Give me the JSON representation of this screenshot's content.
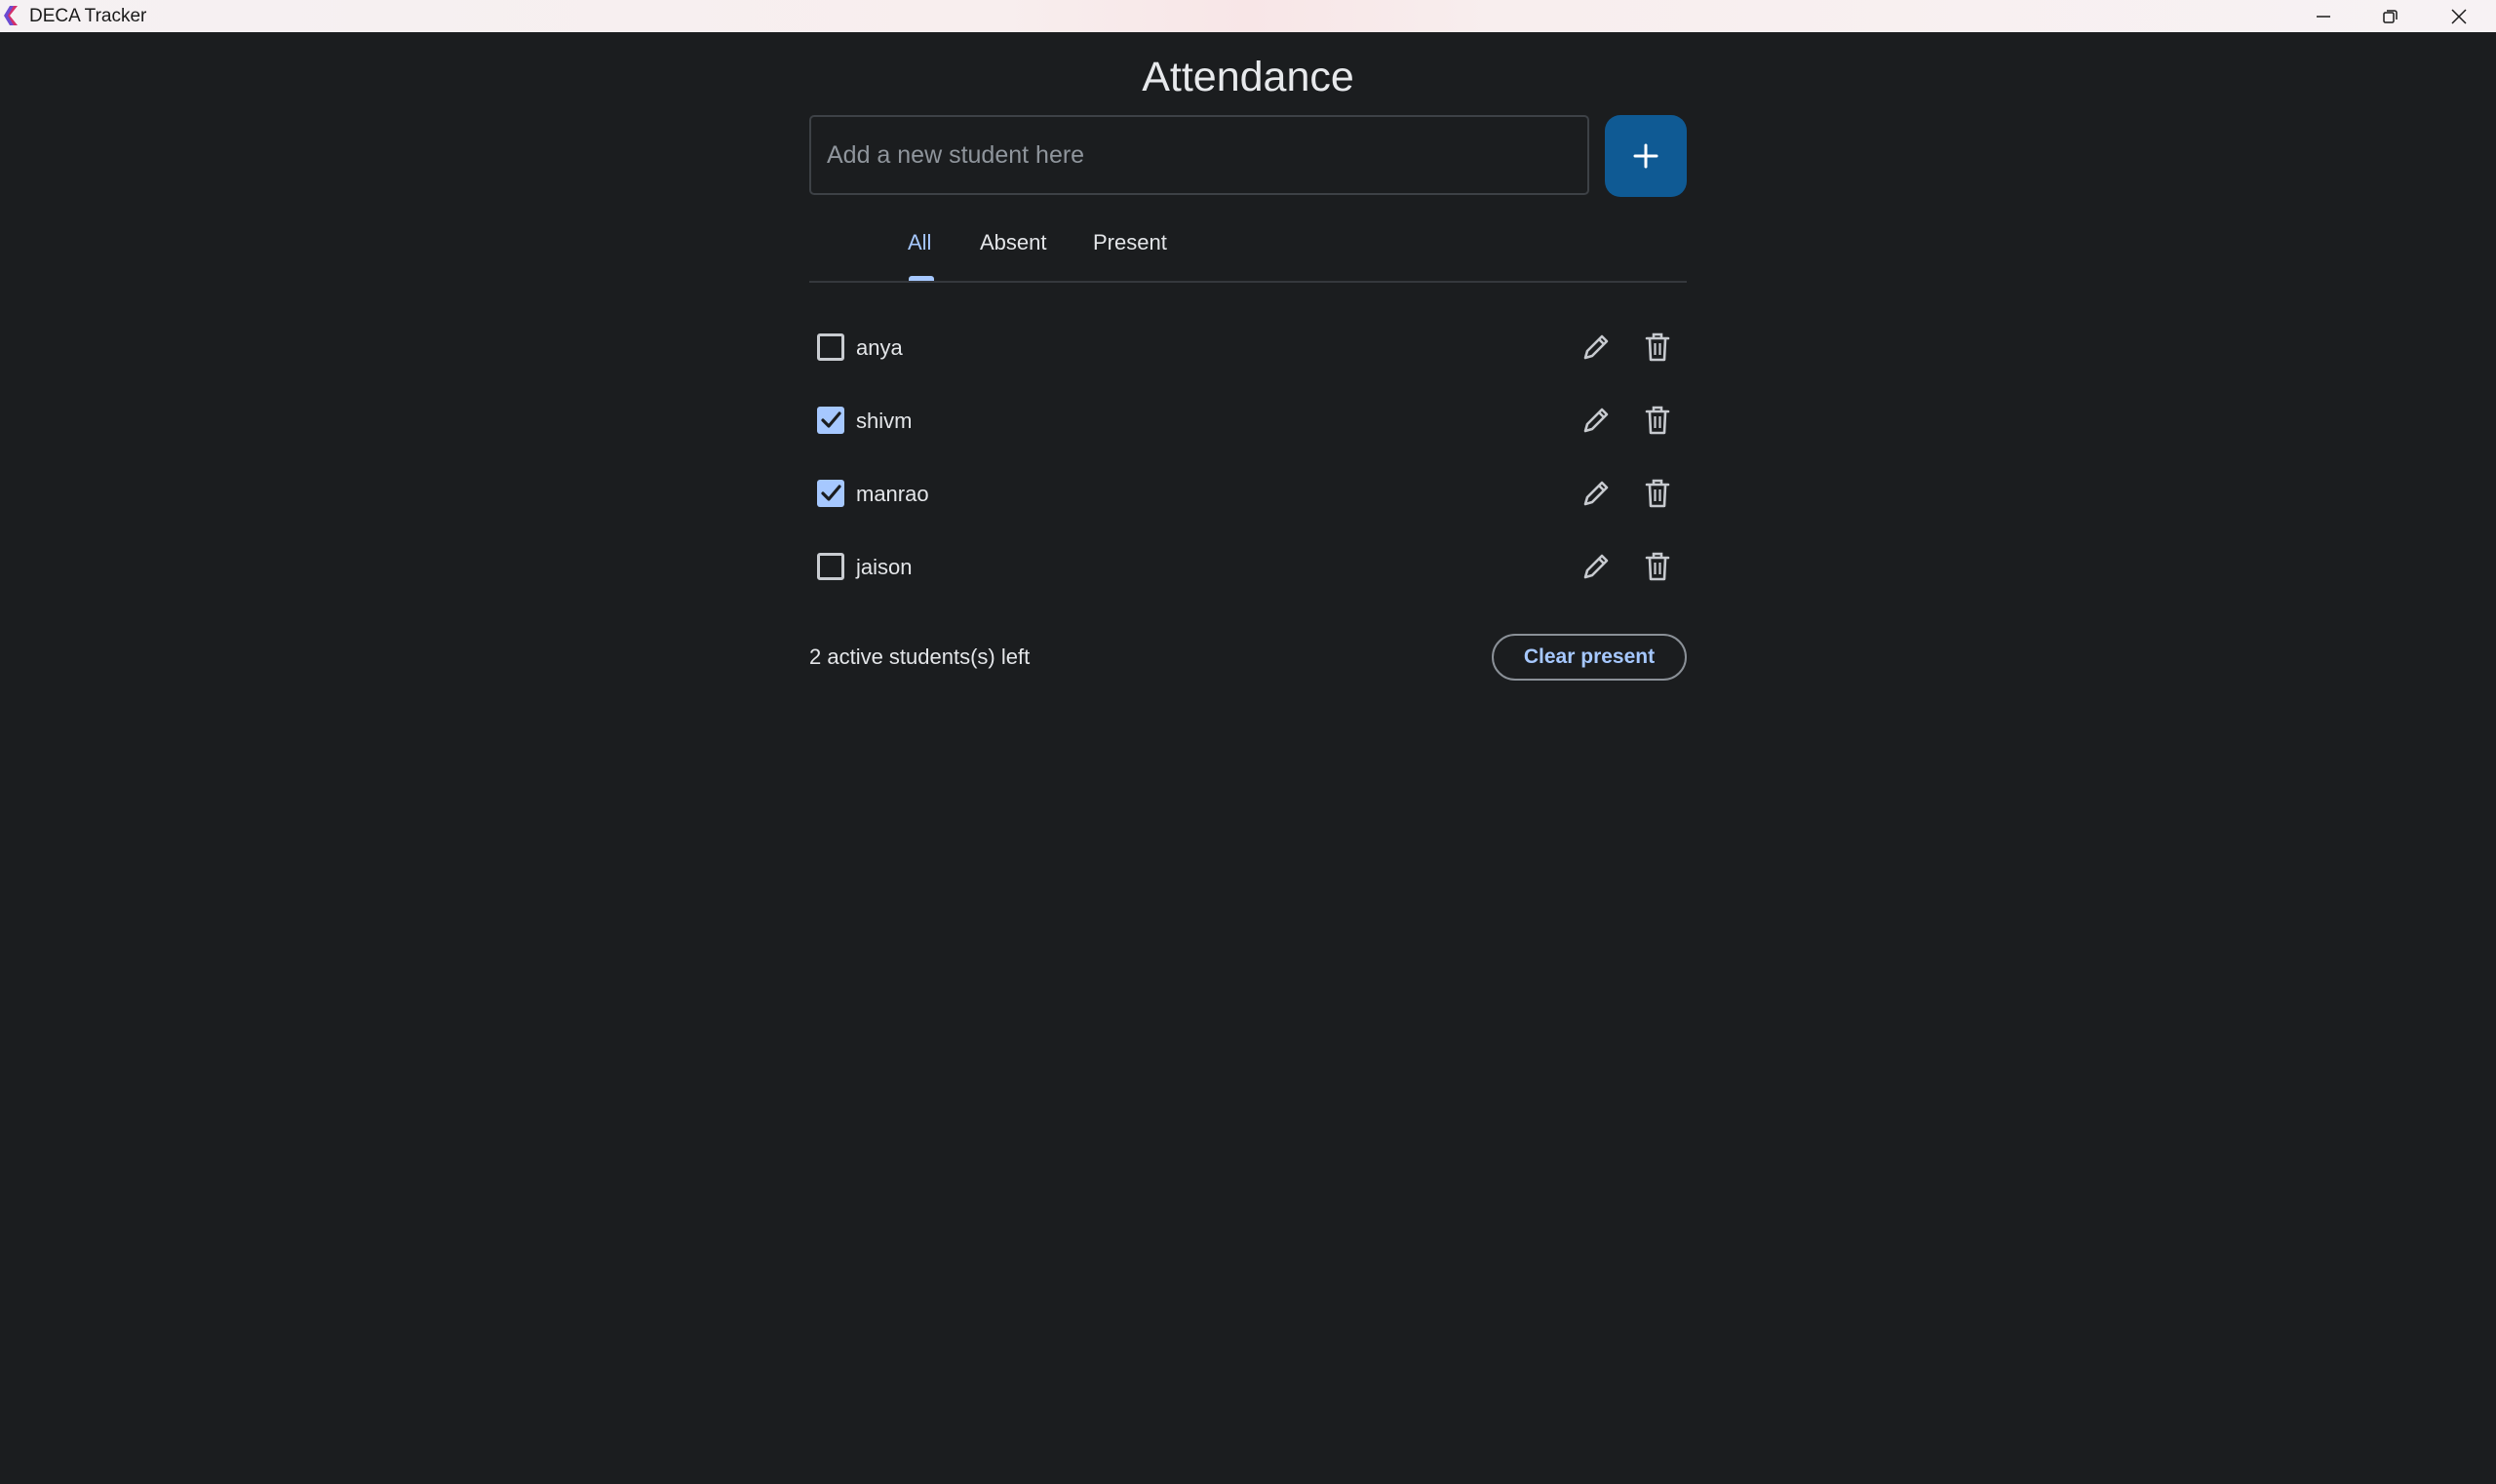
{
  "window": {
    "title": "DECA Tracker"
  },
  "header": {
    "title": "Attendance"
  },
  "new_student": {
    "placeholder": "Add a new student here",
    "value": "",
    "add_icon": "plus-icon"
  },
  "tabs": [
    {
      "label": "All",
      "selected": true
    },
    {
      "label": "Absent",
      "selected": false
    },
    {
      "label": "Present",
      "selected": false
    }
  ],
  "students": [
    {
      "name": "anya",
      "present": false
    },
    {
      "name": "shivm",
      "present": true
    },
    {
      "name": "manrao",
      "present": true
    },
    {
      "name": "jaison",
      "present": false
    }
  ],
  "footer": {
    "count_text": "2 active students(s) left",
    "clear_label": "Clear present"
  },
  "colors": {
    "background": "#1b1d1f",
    "accent": "#a6c8ff",
    "add_button": "#0f5a94",
    "titlebar": "#f7eff1"
  }
}
